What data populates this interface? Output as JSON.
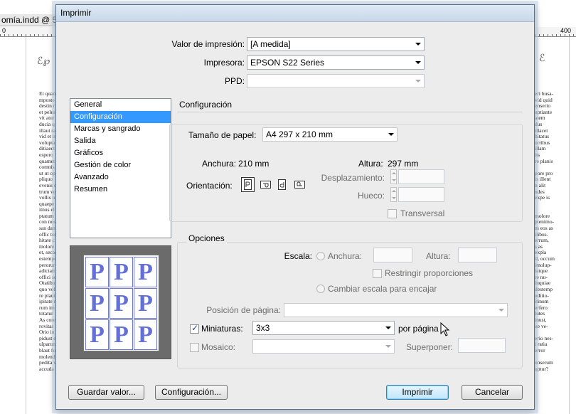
{
  "background": {
    "document_tab": "omía.indd @ 5",
    "ruler_left_zero": "0",
    "ruler_right_value": "400",
    "left_column_lines": [
      "Et quam",
      "mposte",
      "destin r",
      "et peles",
      "vit atur",
      "ducia q",
      "illaut ra",
      "vid et is",
      "volupta",
      "ditiaect",
      "espero",
      "quamet",
      "comnis",
      "ut ut op",
      "pliquo",
      "evenis e",
      "trum ve",
      "vollis ui",
      "quaepe",
      "itnus el",
      "ptatum",
      "con nos",
      "san dan",
      "offic tol",
      "hitate c",
      "molore",
      "et, secae",
      "estempo",
      "perorur",
      "adictati",
      "offici se",
      "Otatibu",
      "quo vol",
      "re plaut",
      "ipitate r",
      "rum im",
      "totatur",
      "As core",
      "rovitas",
      "Orio in",
      "pidust e",
      "ulparun",
      "blaut fu",
      "molend",
      "pedita v",
      "accuda"
    ],
    "right_column_lines": [
      "eri busa-",
      "vid quid",
      "onserio",
      "uptiante",
      "atem",
      "dus",
      "illacet",
      "hitatus",
      "orribus",
      "illam",
      "its",
      "re planis",
      "",
      "pore pro",
      "is illent",
      "n alit",
      "ndes",
      "expe is",
      "",
      "",
      "molore",
      "ptenimo-",
      "m eos as",
      "ilibus.",
      "errum,",
      "s as",
      "expla",
      "il, occum",
      "imolup-",
      "iatque",
      "re nu-",
      "inquiae",
      "destemp",
      "uditio-",
      "itinum",
      "erfero",
      "lutes",
      "inust,",
      "ue ve-",
      "",
      "erio nes-",
      "i ratia",
      "error",
      "",
      "onserum",
      "uptur?"
    ]
  },
  "dialog": {
    "title": "Imprimir",
    "print_preset": {
      "label": "Valor de impresión:",
      "value": "[A medida]"
    },
    "printer": {
      "label": "Impresora:",
      "value": "EPSON S22 Series"
    },
    "ppd": {
      "label": "PPD:",
      "value": ""
    },
    "categories": [
      "General",
      "Configuración",
      "Marcas y sangrado",
      "Salida",
      "Gráficos",
      "Gestión de color",
      "Avanzado",
      "Resumen"
    ],
    "selected_category": "Configuración",
    "section_title": "Configuración",
    "paper_size": {
      "label": "Tamaño de papel:",
      "value": "A4 297 x 210 mm"
    },
    "width": {
      "label": "Anchura:",
      "value": "210 mm"
    },
    "height": {
      "label": "Altura:",
      "value": "297 mm"
    },
    "offset_label": "Desplazamiento:",
    "gap_label": "Hueco:",
    "transverse_label": "Transversal",
    "orientation_label": "Orientación:",
    "options_title": "Opciones",
    "scale_label": "Escala:",
    "scale_width_label": "Anchura:",
    "scale_height_label": "Altura:",
    "constrain_label": "Restringir proporciones",
    "scale_to_fit_label": "Cambiar escala para encajar",
    "page_position_label": "Posición de página:",
    "page_position_value": "",
    "thumbnails": {
      "label": "Miniaturas:",
      "checked": true,
      "value": "3x3",
      "suffix": "por página"
    },
    "tile": {
      "label": "Mosaico:",
      "checked": false,
      "value": ""
    },
    "overlap_label": "Superponer:",
    "preview_letter": "P",
    "buttons": {
      "save_preset": "Guardar valor...",
      "setup": "Configuración...",
      "print": "Imprimir",
      "cancel": "Cancelar"
    },
    "colors": {
      "selection": "#3399ff",
      "dialog_bg": "#ececec",
      "preview_glyph": "#6570d6"
    }
  }
}
